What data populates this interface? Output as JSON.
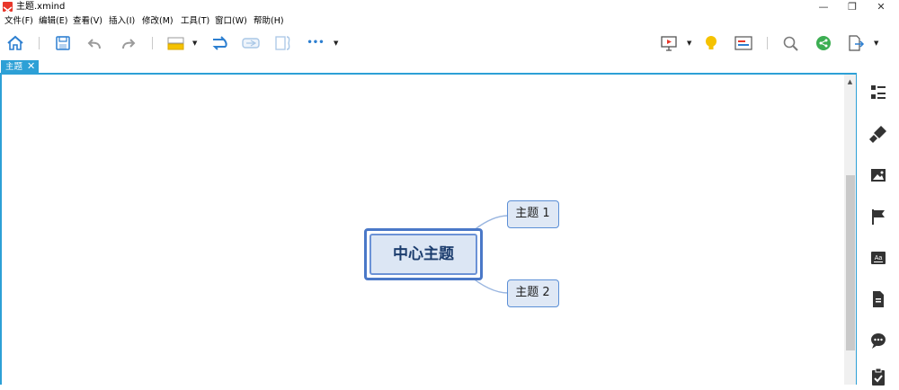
{
  "window": {
    "title": "主题.xmind",
    "minimize_glyph": "—",
    "maximize_glyph": "❐",
    "close_glyph": "✕"
  },
  "menu": [
    "文件(F)",
    "编辑(E)",
    "查看(V)",
    "插入(I)",
    "修改(M)",
    "工具(T)",
    "窗口(W)",
    "帮助(H)"
  ],
  "toolbar": {
    "left_icons": [
      "home-icon",
      "save-icon",
      "undo-icon",
      "redo-icon",
      "topic-insert-icon",
      "relationship-icon",
      "boundary-icon",
      "summary-icon",
      "more-icon"
    ],
    "right_icons": [
      "presentation-icon",
      "lightbulb-icon",
      "outline-icon",
      "search-icon",
      "share-icon",
      "export-icon"
    ],
    "more_glyph": "•••"
  },
  "tab": {
    "label": "主题",
    "close_glyph": "✕"
  },
  "mindmap": {
    "central_topic": "中心主题",
    "subtopics": [
      "主题 1",
      "主题 2"
    ]
  },
  "right_panel_icons": [
    "outline-icon",
    "format-icon",
    "image-icon",
    "marker-icon",
    "text-style-icon",
    "notes-icon",
    "comments-icon",
    "task-icon"
  ],
  "colors": {
    "accent": "#2da0d6",
    "central_border": "#4a78c8",
    "topic_border": "#5b8fd6",
    "topic_fill": "#dfe8f5",
    "logo": "#e8372b"
  }
}
